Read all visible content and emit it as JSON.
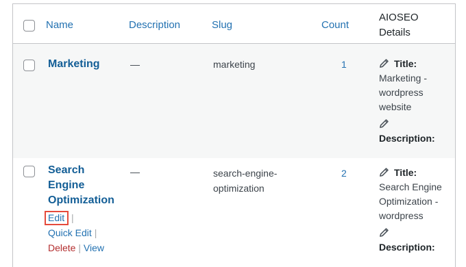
{
  "columns": {
    "name": "Name",
    "description": "Description",
    "slug": "Slug",
    "count": "Count",
    "aioseo_line1": "AIOSEO",
    "aioseo_line2": "Details"
  },
  "rows": [
    {
      "name": "Marketing",
      "description": "—",
      "slug": "marketing",
      "count": "1",
      "seo_title_label": "Title:",
      "seo_title_lines": [
        "Marketing -",
        "wordpress",
        "website"
      ],
      "seo_desc_label": "Description:"
    },
    {
      "name_lines": [
        "Search",
        "Engine",
        "Optimization"
      ],
      "description": "—",
      "slug_lines": [
        "search-engine-",
        "optimization"
      ],
      "count": "2",
      "actions": {
        "edit": "Edit",
        "quick_edit": "Quick Edit",
        "delete": "Delete",
        "view": "View",
        "separator": "|"
      },
      "seo_title_label": "Title:",
      "seo_title_lines": [
        "Search Engine",
        "Optimization -",
        "wordpress"
      ],
      "seo_desc_label": "Description:"
    }
  ],
  "icons": {
    "pencil": "pencil-icon",
    "highlight_color": "#e54a3b"
  }
}
